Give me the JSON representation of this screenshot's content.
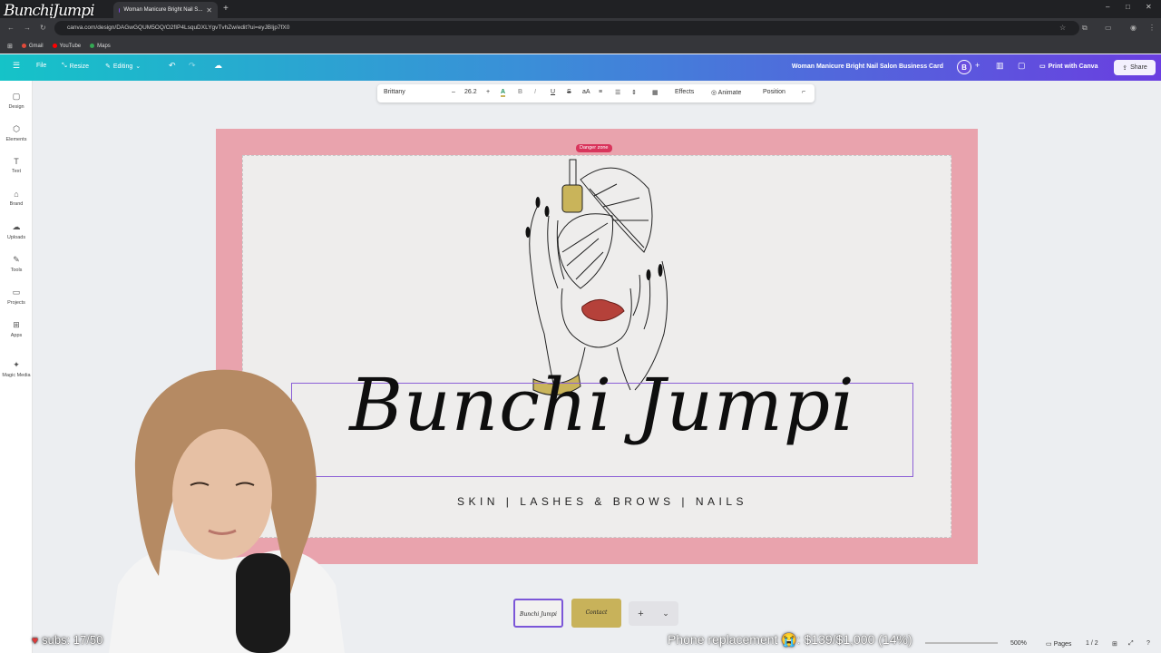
{
  "stream": {
    "overlay_logo": "BunchiJumpi",
    "subs_goal": "subs: 17/50",
    "donation_goal": "Phone replacement 😭: $139/$1,000 (14%)",
    "donation_progress": 0.14
  },
  "browser": {
    "tab_title": "Woman Manicure Bright Nail S...",
    "url": "canva.com/design/DAGwGQUM5OQ/O2fIP4LsquDXLYgvTvhZw/edit?ui=eyJBIjp7fX0",
    "bookmarks": [
      "Gmail",
      "YouTube",
      "Maps"
    ],
    "window_controls": [
      "–",
      "□",
      "✕"
    ]
  },
  "topbar": {
    "menu_icon": "☰",
    "file": "File",
    "resize": "Resize",
    "editing": "Editing",
    "doc_title": "Woman Manicure Bright Nail Salon Business Card",
    "avatar": "B",
    "print": "Print with Canva",
    "share": "Share"
  },
  "sidebar": {
    "items": [
      {
        "label": "Design",
        "icon": "▢"
      },
      {
        "label": "Elements",
        "icon": "⬡"
      },
      {
        "label": "Text",
        "icon": "T"
      },
      {
        "label": "Brand",
        "icon": "⌂"
      },
      {
        "label": "Uploads",
        "icon": "☁"
      },
      {
        "label": "Tools",
        "icon": "✎"
      },
      {
        "label": "Projects",
        "icon": "▭"
      },
      {
        "label": "Apps",
        "icon": "⊞"
      },
      {
        "label": "Magic Media",
        "icon": "✦"
      }
    ]
  },
  "text_toolbar": {
    "font": "Brittany",
    "minus": "–",
    "size": "26.2",
    "plus": "+",
    "color_letter": "A",
    "bold": "B",
    "italic": "I",
    "underline": "U",
    "strike": "S",
    "case": "aA",
    "effects": "Effects",
    "animate": "Animate",
    "position": "Position"
  },
  "canvas": {
    "danger_zone": "Danger zone",
    "brand_name": "Bunchi Jumpi",
    "tagline": "SKIN | LASHES & BROWS | NAILS"
  },
  "pages": {
    "thumb1_label": "Bunchi Jumpi",
    "thumb2_label": "Contact",
    "add": "+",
    "chevron": "⌄"
  },
  "bottom": {
    "zoom": "500%",
    "pages_label": "Pages",
    "page_count": "1 / 2"
  },
  "colors": {
    "card_border": "#e9a3ad",
    "card_bg": "#eeedec",
    "selection": "#8b5fd6",
    "lips": "#b5413a",
    "gold": "#c9b45a"
  }
}
